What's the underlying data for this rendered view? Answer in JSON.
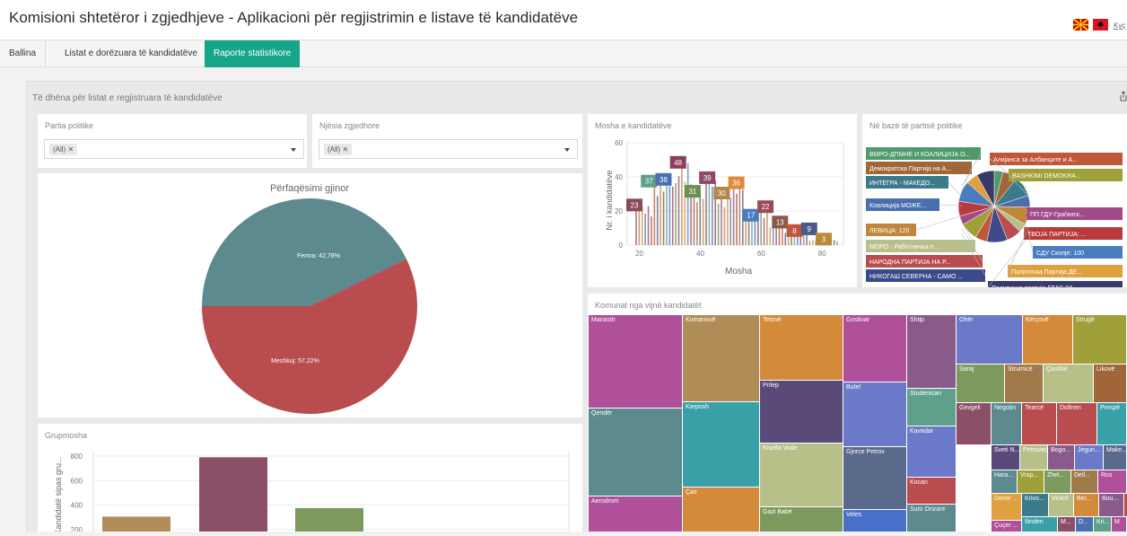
{
  "app": {
    "title": "Komisioni shtetëror i zgjedhjeve - Aplikacioni për regjistrimin e listave të kandidatëve",
    "lang_link": "Kyç"
  },
  "nav": {
    "items": [
      {
        "label": "Ballina",
        "active": false
      },
      {
        "label": "Listat e dorëzuara të kandidatëve",
        "active": false
      },
      {
        "label": "Raporte statistikore",
        "active": true
      }
    ]
  },
  "dashboard": {
    "title": "Të dhëna për listat e regjistruara të kandidatëve"
  },
  "filters": {
    "party": {
      "title": "Partia politike",
      "value": "(All) ✕"
    },
    "unit": {
      "title": "Njësia zgjedhore",
      "value": "(All) ✕"
    }
  },
  "gender": {
    "title": "Përfaqësimi gjinor",
    "slices": [
      {
        "label": "Femra: 42,78%",
        "value": 42.78,
        "color": "#5c8a8f"
      },
      {
        "label": "Meshkuj: 57,22%",
        "value": 57.22,
        "color": "#b84c4f"
      }
    ]
  },
  "age": {
    "title": "Mosha e kandidatëve",
    "xlabel": "Mosha",
    "ylabel": "Nr. i kandidatëve",
    "yticks": [
      "0",
      "20",
      "40",
      "60"
    ],
    "xticks": [
      "20",
      "40",
      "60",
      "80"
    ],
    "callouts": [
      {
        "label": "23",
        "color": "#8b4a5a"
      },
      {
        "label": "37",
        "color": "#5fa08a"
      },
      {
        "label": "38",
        "color": "#4a6fae"
      },
      {
        "label": "48",
        "color": "#8b3f5c"
      },
      {
        "label": "31",
        "color": "#6d8f50"
      },
      {
        "label": "39",
        "color": "#8c4a6a"
      },
      {
        "label": "30",
        "color": "#b0864a"
      },
      {
        "label": "36",
        "color": "#e08a3a"
      },
      {
        "label": "17",
        "color": "#4a7cc0"
      },
      {
        "label": "22",
        "color": "#9c4a58"
      },
      {
        "label": "13",
        "color": "#8a5a4a"
      },
      {
        "label": "8",
        "color": "#c0563a"
      },
      {
        "label": "9",
        "color": "#4a5a8a"
      },
      {
        "label": "3",
        "color": "#b88a3a"
      }
    ]
  },
  "party_chart": {
    "title": "Në bazë të partisë politike",
    "labels": [
      {
        "label": "ВМРО-ДПМНЕ И КОАЛИЦИЈА О...",
        "color": "#4e9a6a"
      },
      {
        "label": "Демократска Партија на А...",
        "color": "#a0663a"
      },
      {
        "label": "ИНТЕГРА - МАКЕДО...",
        "color": "#3a7a8a"
      },
      {
        "label": "Коалиција МОЖЕ...",
        "color": "#4a6fae"
      },
      {
        "label": "ЛЕВИЦА: 120",
        "color": "#c0863a"
      },
      {
        "label": "МОРО - Работничка п...",
        "color": "#b8c08a"
      },
      {
        "label": "НАРОДНА ПАРТИЈА НА Р...",
        "color": "#b84c4f"
      },
      {
        "label": "НИКОГАШ СЕВЕРНА - САМО ...",
        "color": "#3a4a8a"
      },
      {
        "label": "Алијанса за Албанците и А...",
        "color": "#c0563a"
      },
      {
        "label": "BASHKIMI DEMOKRA...",
        "color": "#a0a03a"
      },
      {
        "label": "ПП ГДУ-Граѓанск...",
        "color": "#a04a8a"
      },
      {
        "label": "ТВОЈА ПАРТИЈА: ...",
        "color": "#b83a3a"
      },
      {
        "label": "СДУ Скопје: 100",
        "color": "#4a7cc0"
      },
      {
        "label": "Политичка Партија ДЕ...",
        "color": "#e0a040"
      },
      {
        "label": "Политичка партија ГЛАС ЗА ...",
        "color": "#3a3a6a"
      }
    ]
  },
  "grupmosha": {
    "title": "Grupmosha",
    "ylabel": "Kandidatë sipas gru...",
    "yticks": [
      "200",
      "400",
      "600",
      "800"
    ],
    "ylim": [
      0,
      800
    ],
    "bars": [
      {
        "value": 305,
        "color": "#b08d57"
      },
      {
        "value": 790,
        "color": "#8c4f68"
      },
      {
        "value": 375,
        "color": "#7d9a5e"
      }
    ]
  },
  "komuna": {
    "title": "Komunat nga vijnë kandidatët",
    "cells": [
      {
        "label": "Manastir",
        "color": "#b04f9a"
      },
      {
        "label": "Qendër",
        "color": "#5c8a8f"
      },
      {
        "label": "Aerodrom",
        "color": "#b04f9a"
      },
      {
        "label": "Kumanovë",
        "color": "#b08d57"
      },
      {
        "label": "Karposh",
        "color": "#3aa0a8"
      },
      {
        "label": "Çair",
        "color": "#d38a3a"
      },
      {
        "label": "Tetovë",
        "color": "#d38a3a"
      },
      {
        "label": "Prilep",
        "color": "#5a4a7a"
      },
      {
        "label": "Kisella Vode",
        "color": "#b8c08a"
      },
      {
        "label": "Gazi Babë",
        "color": "#7d9a5e"
      },
      {
        "label": "Gostivar",
        "color": "#b04f9a"
      },
      {
        "label": "Butel",
        "color": "#6a7ac8"
      },
      {
        "label": "Gjorce Petrov",
        "color": "#5a6a8a"
      },
      {
        "label": "Veles",
        "color": "#4a6fc8"
      },
      {
        "label": "Shtip",
        "color": "#8a5a8a"
      },
      {
        "label": "Studenican",
        "color": "#5fa08a"
      },
      {
        "label": "Kavadar",
        "color": "#6a7ac8"
      },
      {
        "label": "Kocan",
        "color": "#b84c4f"
      },
      {
        "label": "Suto Orizare",
        "color": "#5c8a8f"
      },
      {
        "label": "Dibër",
        "color": "#b04f9a"
      },
      {
        "label": "Ohër",
        "color": "#6a7ac8"
      },
      {
        "label": "Saraj",
        "color": "#7d9a5e"
      },
      {
        "label": "Strumicë",
        "color": "#a07a4a"
      },
      {
        "label": "Gevgeli",
        "color": "#8c4f68"
      },
      {
        "label": "Negotin",
        "color": "#5c8a8f"
      },
      {
        "label": "Tearcë",
        "color": "#b84c4f"
      },
      {
        "label": "Kërçovë",
        "color": "#d38a3a"
      },
      {
        "label": "Strugë",
        "color": "#a0a03a"
      },
      {
        "label": "Çashkë",
        "color": "#b8c08a"
      },
      {
        "label": "Likovë",
        "color": "#a0663a"
      },
      {
        "label": "Dollnen",
        "color": "#b84c4f"
      },
      {
        "label": "Prespë",
        "color": "#3aa0a8"
      },
      {
        "label": "Sveti N...",
        "color": "#5a4a7a"
      },
      {
        "label": "Petrovec",
        "color": "#b8c08a"
      },
      {
        "label": "Bogo...",
        "color": "#8a5a8a"
      },
      {
        "label": "Jegun...",
        "color": "#6a7ac8"
      },
      {
        "label": "Make...",
        "color": "#5a6a8a"
      },
      {
        "label": "Hara...",
        "color": "#5c8a8f"
      },
      {
        "label": "Vrap...",
        "color": "#a0a03a"
      },
      {
        "label": "Zhel...",
        "color": "#7d9a5e"
      },
      {
        "label": "Dell...",
        "color": "#a07a4a"
      },
      {
        "label": "Ros",
        "color": "#b04f9a"
      },
      {
        "label": "Demir ...",
        "color": "#e0a040"
      },
      {
        "label": "Krivo...",
        "color": "#3a7a8a"
      },
      {
        "label": "Vinicë",
        "color": "#b8c08a"
      },
      {
        "label": "Ber...",
        "color": "#d38a3a"
      },
      {
        "label": "Bou...",
        "color": "#8a5a8a"
      },
      {
        "label": "Krat",
        "color": "#b84c4f"
      },
      {
        "label": "Çuçer ...",
        "color": "#b04f9a"
      },
      {
        "label": "Ilinden",
        "color": "#3aa0a8"
      },
      {
        "label": "M...",
        "color": "#8c4f68"
      },
      {
        "label": "D...",
        "color": "#4a6fae"
      },
      {
        "label": "Kri...",
        "color": "#5fa08a"
      },
      {
        "label": "M",
        "color": "#b04f9a"
      }
    ]
  }
}
